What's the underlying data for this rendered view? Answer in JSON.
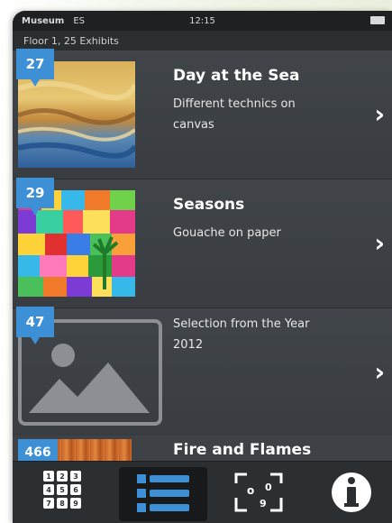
{
  "status_bar": {
    "carrier": "Museum",
    "network": "ES",
    "time": "12:15"
  },
  "subheader": {
    "text": "Floor 1, 25 Exhibits"
  },
  "exhibits": [
    {
      "number": "27",
      "title": "Day at the Sea",
      "description": "Different technics on canvas",
      "thumb_icon": "painting-seascape"
    },
    {
      "number": "29",
      "title": "Seasons",
      "description": "Gouache on paper",
      "thumb_icon": "painting-colorful-city"
    },
    {
      "number": "47",
      "title": "",
      "description": "Selection from the Year 2012",
      "thumb_icon": "image-placeholder-icon"
    }
  ],
  "partial_exhibit": {
    "number": "466",
    "title": "Fire and Flames"
  },
  "tabbar": {
    "tabs": [
      {
        "icon": "keypad-icon",
        "active": false
      },
      {
        "icon": "list-icon",
        "active": true
      },
      {
        "icon": "map-icon",
        "active": false
      },
      {
        "icon": "info-icon",
        "active": false
      }
    ]
  },
  "colors": {
    "badge": "#3d8fd6",
    "background": "#3b3f42",
    "tabbar": "#2c2f31"
  }
}
